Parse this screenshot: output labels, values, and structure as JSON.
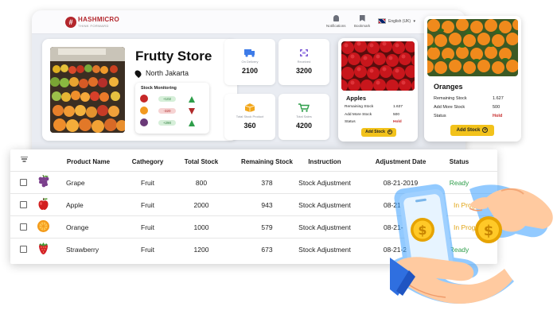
{
  "header": {
    "brand": "HASHMICRO",
    "tagline": "THINK FORWARD",
    "nav": [
      {
        "label": "Notifications",
        "icon": "bell-icon"
      },
      {
        "label": "Bookmark",
        "icon": "bookmark-icon"
      }
    ],
    "language": "English (UK)"
  },
  "store": {
    "name": "Frutty Store",
    "location": "North Jakarta",
    "stock_monitoring": {
      "title": "Stock Monitoring",
      "rows": [
        {
          "fruit": "apple",
          "change": "+102",
          "trend": "up",
          "color": "#2e9e4a"
        },
        {
          "fruit": "orange",
          "change": "-320",
          "trend": "down",
          "color": "#b02a2a"
        },
        {
          "fruit": "grape",
          "change": "+290",
          "trend": "up",
          "color": "#2e9e4a"
        }
      ]
    }
  },
  "stats": [
    {
      "label": "On Delivery",
      "value": "2100",
      "icon": "truck-icon",
      "color": "#3d7be8"
    },
    {
      "label": "Received",
      "value": "3200",
      "icon": "received-icon",
      "color": "#7e5bd6"
    },
    {
      "label": "Total Stock Product",
      "value": "360",
      "icon": "box-icon",
      "color": "#f2a71b"
    },
    {
      "label": "Total Sales",
      "value": "4200",
      "icon": "cart-icon",
      "color": "#2e9e4a"
    }
  ],
  "products": [
    {
      "name": "Apples",
      "remaining_label": "Remaining Stock",
      "remaining": "1.637",
      "add_label": "Add More Stock",
      "add": "500",
      "status_label": "Status",
      "status": "Hold",
      "button": "Add Stock"
    },
    {
      "name": "Oranges",
      "remaining_label": "Remaining Stock",
      "remaining": "1.627",
      "add_label": "Add More Stock",
      "add": "500",
      "status_label": "Status",
      "status": "Hold",
      "button": "Add Stock"
    }
  ],
  "table": {
    "columns": [
      "Product Name",
      "Cathegory",
      "Total Stock",
      "Remaining Stock",
      "Instruction",
      "Adjustment Date",
      "Status"
    ],
    "rows": [
      {
        "icon": "grape-icon",
        "name": "Grape",
        "category": "Fruit",
        "total": "800",
        "remaining": "378",
        "instruction": "Stock Adjustment",
        "date": "08-21-2019",
        "status": "Ready"
      },
      {
        "icon": "apple-icon",
        "name": "Apple",
        "category": "Fruit",
        "total": "2000",
        "remaining": "943",
        "instruction": "Stock Adjustment",
        "date": "08-21-",
        "status": "In Progress"
      },
      {
        "icon": "orange-icon",
        "name": "Orange",
        "category": "Fruit",
        "total": "1000",
        "remaining": "579",
        "instruction": "Stock Adjustment",
        "date": "08-21-",
        "status": "In Progress"
      },
      {
        "icon": "strawberry-icon",
        "name": "Strawberry",
        "category": "Fruit",
        "total": "1200",
        "remaining": "673",
        "instruction": "Stock Adjustment",
        "date": "08-21-2019",
        "status": "Ready"
      }
    ]
  },
  "illustration": {
    "coin_symbol": "$"
  }
}
